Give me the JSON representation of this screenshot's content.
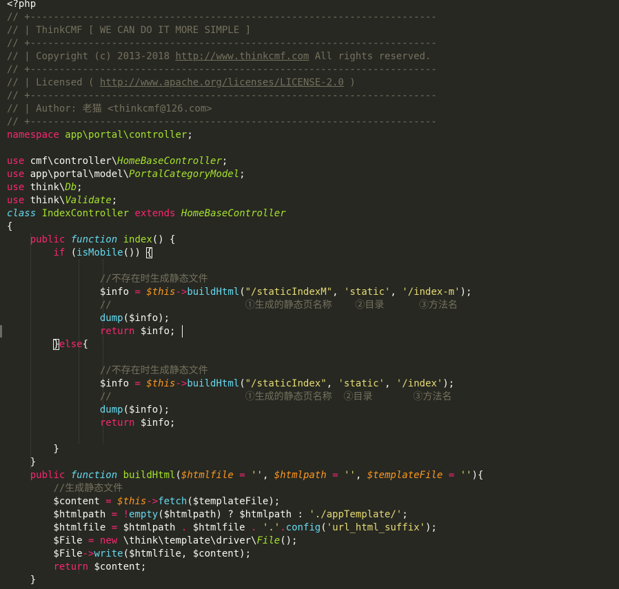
{
  "code_lines": [
    [
      [
        "n",
        "<?php"
      ]
    ],
    [
      [
        "c",
        "// +----------------------------------------------------------------------"
      ]
    ],
    [
      [
        "c",
        "// | ThinkCMF [ WE CAN DO IT MORE SIMPLE ]"
      ]
    ],
    [
      [
        "c",
        "// +----------------------------------------------------------------------"
      ]
    ],
    [
      [
        "c",
        "// | Copyright (c) 2013-2018 "
      ],
      [
        "cu",
        "http://www.thinkcmf.com"
      ],
      [
        "c",
        " All rights reserved."
      ]
    ],
    [
      [
        "c",
        "// +----------------------------------------------------------------------"
      ]
    ],
    [
      [
        "c",
        "// | Licensed ( "
      ],
      [
        "cu",
        "http://www.apache.org/licenses/LICENSE-2.0"
      ],
      [
        "c",
        " )"
      ]
    ],
    [
      [
        "c",
        "// +----------------------------------------------------------------------"
      ]
    ],
    [
      [
        "c",
        "// | Author: 老猫 <thinkcmf@126.com>"
      ]
    ],
    [
      [
        "c",
        "// +----------------------------------------------------------------------"
      ]
    ],
    [
      [
        "k",
        "namespace"
      ],
      [
        "n",
        " "
      ],
      [
        "g",
        "app\\portal\\controller"
      ],
      [
        "n",
        ";"
      ]
    ],
    [],
    [
      [
        "k",
        "use"
      ],
      [
        "n",
        " cmf\\controller\\"
      ],
      [
        "gi",
        "HomeBaseController"
      ],
      [
        "n",
        ";"
      ]
    ],
    [
      [
        "k",
        "use"
      ],
      [
        "n",
        " app\\portal\\model\\"
      ],
      [
        "gi",
        "PortalCategoryModel"
      ],
      [
        "n",
        ";"
      ]
    ],
    [
      [
        "k",
        "use"
      ],
      [
        "n",
        " think\\"
      ],
      [
        "gi",
        "Db"
      ],
      [
        "n",
        ";"
      ]
    ],
    [
      [
        "k",
        "use"
      ],
      [
        "n",
        " think\\"
      ],
      [
        "gi",
        "Validate"
      ],
      [
        "n",
        ";"
      ]
    ],
    [
      [
        "t",
        "class"
      ],
      [
        "n",
        " "
      ],
      [
        "g",
        "IndexController"
      ],
      [
        "n",
        " "
      ],
      [
        "k",
        "extends"
      ],
      [
        "n",
        " "
      ],
      [
        "gi",
        "HomeBaseController"
      ]
    ],
    [
      [
        "n",
        "{"
      ]
    ],
    [
      [
        "n",
        "    "
      ],
      [
        "k",
        "public"
      ],
      [
        "n",
        " "
      ],
      [
        "t",
        "function"
      ],
      [
        "n",
        " "
      ],
      [
        "g",
        "index"
      ],
      [
        "n",
        "() {"
      ]
    ],
    [
      [
        "n",
        "        "
      ],
      [
        "k",
        "if"
      ],
      [
        "n",
        " ("
      ],
      [
        "f",
        "isMobile"
      ],
      [
        "n",
        "()) "
      ],
      [
        "bm",
        "{"
      ]
    ],
    [],
    [
      [
        "n",
        "                "
      ],
      [
        "c",
        "//不存在时生成静态文件"
      ]
    ],
    [
      [
        "n",
        "                $info "
      ],
      [
        "k",
        "="
      ],
      [
        "n",
        " "
      ],
      [
        "v",
        "$this"
      ],
      [
        "k",
        "->"
      ],
      [
        "f",
        "buildHtml"
      ],
      [
        "n",
        "("
      ],
      [
        "s",
        "\"/staticIndexM\""
      ],
      [
        "n",
        ", "
      ],
      [
        "s",
        "'static'"
      ],
      [
        "n",
        ", "
      ],
      [
        "s",
        "'/index-m'"
      ],
      [
        "n",
        ");"
      ]
    ],
    [
      [
        "n",
        "                "
      ],
      [
        "c",
        "//                       ①生成的静态页名称    ②目录      ③方法名"
      ]
    ],
    [
      [
        "n",
        "                "
      ],
      [
        "f",
        "dump"
      ],
      [
        "n",
        "($info);"
      ]
    ],
    [
      [
        "n",
        "                "
      ],
      [
        "k",
        "return"
      ],
      [
        "n",
        " $info;"
      ]
    ],
    [
      [
        "n",
        "        "
      ],
      [
        "bm",
        "}"
      ],
      [
        "k",
        "else"
      ],
      [
        "n",
        "{"
      ]
    ],
    [],
    [
      [
        "n",
        "                "
      ],
      [
        "c",
        "//不存在时生成静态文件"
      ]
    ],
    [
      [
        "n",
        "                $info "
      ],
      [
        "k",
        "="
      ],
      [
        "n",
        " "
      ],
      [
        "v",
        "$this"
      ],
      [
        "k",
        "->"
      ],
      [
        "f",
        "buildHtml"
      ],
      [
        "n",
        "("
      ],
      [
        "s",
        "\"/staticIndex\""
      ],
      [
        "n",
        ", "
      ],
      [
        "s",
        "'static'"
      ],
      [
        "n",
        ", "
      ],
      [
        "s",
        "'/index'"
      ],
      [
        "n",
        ");"
      ]
    ],
    [
      [
        "n",
        "                "
      ],
      [
        "c",
        "//                       ①生成的静态页名称  ②目录       ③方法名"
      ]
    ],
    [
      [
        "n",
        "                "
      ],
      [
        "f",
        "dump"
      ],
      [
        "n",
        "($info);"
      ]
    ],
    [
      [
        "n",
        "                "
      ],
      [
        "k",
        "return"
      ],
      [
        "n",
        " $info;"
      ]
    ],
    [],
    [
      [
        "n",
        "        }"
      ]
    ],
    [
      [
        "n",
        "    }"
      ]
    ],
    [
      [
        "n",
        "    "
      ],
      [
        "k",
        "public"
      ],
      [
        "n",
        " "
      ],
      [
        "t",
        "function"
      ],
      [
        "n",
        " "
      ],
      [
        "g",
        "buildHtml"
      ],
      [
        "n",
        "("
      ],
      [
        "v",
        "$htmlfile"
      ],
      [
        "n",
        " "
      ],
      [
        "k",
        "="
      ],
      [
        "n",
        " "
      ],
      [
        "s",
        "''"
      ],
      [
        "n",
        ", "
      ],
      [
        "v",
        "$htmlpath"
      ],
      [
        "n",
        " "
      ],
      [
        "k",
        "="
      ],
      [
        "n",
        " "
      ],
      [
        "s",
        "''"
      ],
      [
        "n",
        ", "
      ],
      [
        "v",
        "$templateFile"
      ],
      [
        "n",
        " "
      ],
      [
        "k",
        "="
      ],
      [
        "n",
        " "
      ],
      [
        "s",
        "''"
      ],
      [
        "n",
        "){"
      ]
    ],
    [
      [
        "n",
        "        "
      ],
      [
        "c",
        "//生成静态文件"
      ]
    ],
    [
      [
        "n",
        "        $content "
      ],
      [
        "k",
        "="
      ],
      [
        "n",
        " "
      ],
      [
        "v",
        "$this"
      ],
      [
        "k",
        "->"
      ],
      [
        "f",
        "fetch"
      ],
      [
        "n",
        "($templateFile);"
      ]
    ],
    [
      [
        "n",
        "        $htmlpath "
      ],
      [
        "k",
        "="
      ],
      [
        "n",
        " "
      ],
      [
        "k",
        "!"
      ],
      [
        "f",
        "empty"
      ],
      [
        "n",
        "($htmlpath) ? $htmlpath : "
      ],
      [
        "s",
        "'./appTemplate/'"
      ],
      [
        "n",
        ";"
      ]
    ],
    [
      [
        "n",
        "        $htmlfile "
      ],
      [
        "k",
        "="
      ],
      [
        "n",
        " $htmlpath "
      ],
      [
        "k",
        "."
      ],
      [
        "n",
        " $htmlfile "
      ],
      [
        "k",
        "."
      ],
      [
        "n",
        " "
      ],
      [
        "s",
        "'.'"
      ],
      [
        "k",
        "."
      ],
      [
        "f",
        "config"
      ],
      [
        "n",
        "("
      ],
      [
        "s",
        "'url_html_suffix'"
      ],
      [
        "n",
        ");"
      ]
    ],
    [
      [
        "n",
        "        $File "
      ],
      [
        "k",
        "="
      ],
      [
        "n",
        " "
      ],
      [
        "k",
        "new"
      ],
      [
        "n",
        " \\think\\template\\driver\\"
      ],
      [
        "gi",
        "File"
      ],
      [
        "n",
        "();"
      ]
    ],
    [
      [
        "n",
        "        $File"
      ],
      [
        "k",
        "->"
      ],
      [
        "f",
        "write"
      ],
      [
        "n",
        "($htmlfile, $content);"
      ]
    ],
    [
      [
        "n",
        "        "
      ],
      [
        "k",
        "return"
      ],
      [
        "n",
        " $content;"
      ]
    ],
    [
      [
        "n",
        "    }"
      ]
    ]
  ],
  "colors": {
    "background": "#272822",
    "comment": "#75715e",
    "keyword": "#f92672",
    "storage": "#66d9ef",
    "entity": "#a6e22e",
    "string": "#e6db74",
    "variable": "#fd971f",
    "text": "#f8f8f2"
  }
}
